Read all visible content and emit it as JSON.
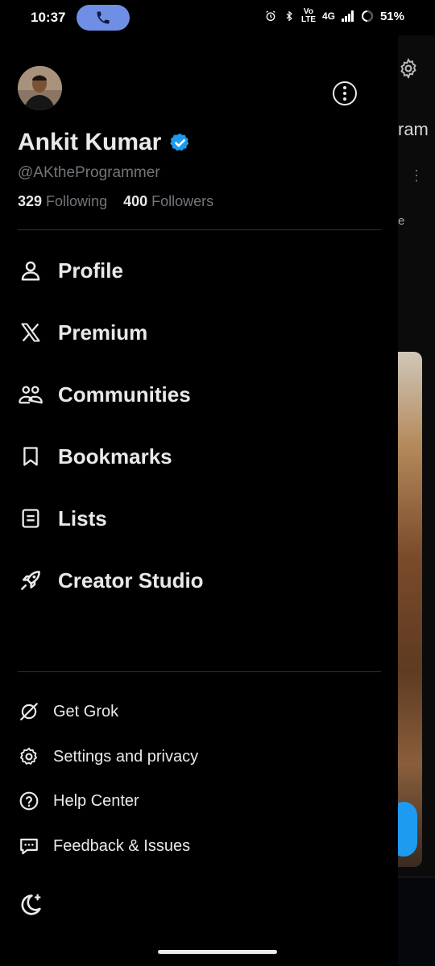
{
  "status_bar": {
    "time": "10:37",
    "network": "4G",
    "volte_label": "Vo LTE",
    "battery": "51%"
  },
  "profile": {
    "name": "Ankit Kumar",
    "handle": "@AKtheProgrammer",
    "following_count": "329",
    "following_label": "Following",
    "followers_count": "400",
    "followers_label": "Followers",
    "verified": true
  },
  "nav": {
    "items": [
      {
        "label": "Profile",
        "icon": "person-icon"
      },
      {
        "label": "Premium",
        "icon": "x-logo-icon"
      },
      {
        "label": "Communities",
        "icon": "communities-icon"
      },
      {
        "label": "Bookmarks",
        "icon": "bookmark-icon"
      },
      {
        "label": "Lists",
        "icon": "list-icon"
      },
      {
        "label": "Creator Studio",
        "icon": "rocket-icon"
      }
    ]
  },
  "secondary": {
    "items": [
      {
        "label": "Get Grok",
        "icon": "grok-icon"
      },
      {
        "label": "Settings and privacy",
        "icon": "gear-icon"
      },
      {
        "label": "Help Center",
        "icon": "help-icon"
      },
      {
        "label": "Feedback & Issues",
        "icon": "feedback-icon"
      }
    ]
  },
  "background_feed": {
    "partial_title": "ram",
    "partial_letter": "e"
  },
  "colors": {
    "background": "#000000",
    "text_primary": "#e7e9ea",
    "text_secondary": "#71767b",
    "accent": "#1d9bf0",
    "call_pill": "#6f8ee6",
    "divider": "#2f3336"
  }
}
